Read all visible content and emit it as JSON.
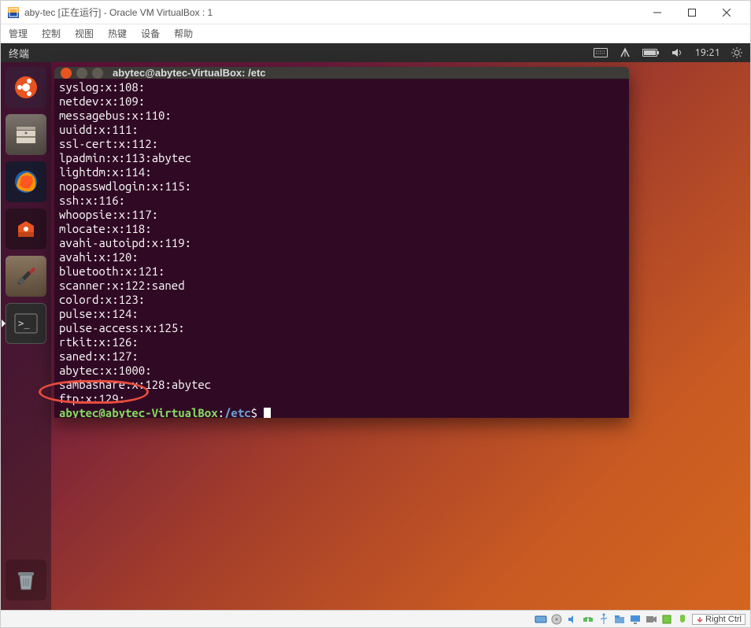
{
  "vb": {
    "title": "aby-tec [正在运行] - Oracle VM VirtualBox : 1",
    "menu": {
      "manage": "管理",
      "control": "控制",
      "view": "视图",
      "hotkeys": "热键",
      "devices": "设备",
      "help": "帮助"
    },
    "hostkey": "Right Ctrl"
  },
  "ubuntu": {
    "panel": {
      "app": "终端",
      "time": "19:21"
    },
    "tooltip": "终端"
  },
  "terminal": {
    "title": "abytec@abytec-VirtualBox: /etc",
    "lines": [
      "syslog:x:108:",
      "netdev:x:109:",
      "messagebus:x:110:",
      "uuidd:x:111:",
      "ssl-cert:x:112:",
      "lpadmin:x:113:abytec",
      "lightdm:x:114:",
      "nopasswdlogin:x:115:",
      "ssh:x:116:",
      "whoopsie:x:117:",
      "mlocate:x:118:",
      "avahi-autoipd:x:119:",
      "avahi:x:120:",
      "bluetooth:x:121:",
      "scanner:x:122:saned",
      "colord:x:123:",
      "pulse:x:124:",
      "pulse-access:x:125:",
      "rtkit:x:126:",
      "saned:x:127:",
      "abytec:x:1000:",
      "sambashare:x:128:abytec",
      "ftp:x:129:"
    ],
    "prompt": {
      "user": "abytec@abytec-VirtualBox",
      "colon": ":",
      "path": "/etc",
      "suffix": "$ "
    }
  }
}
